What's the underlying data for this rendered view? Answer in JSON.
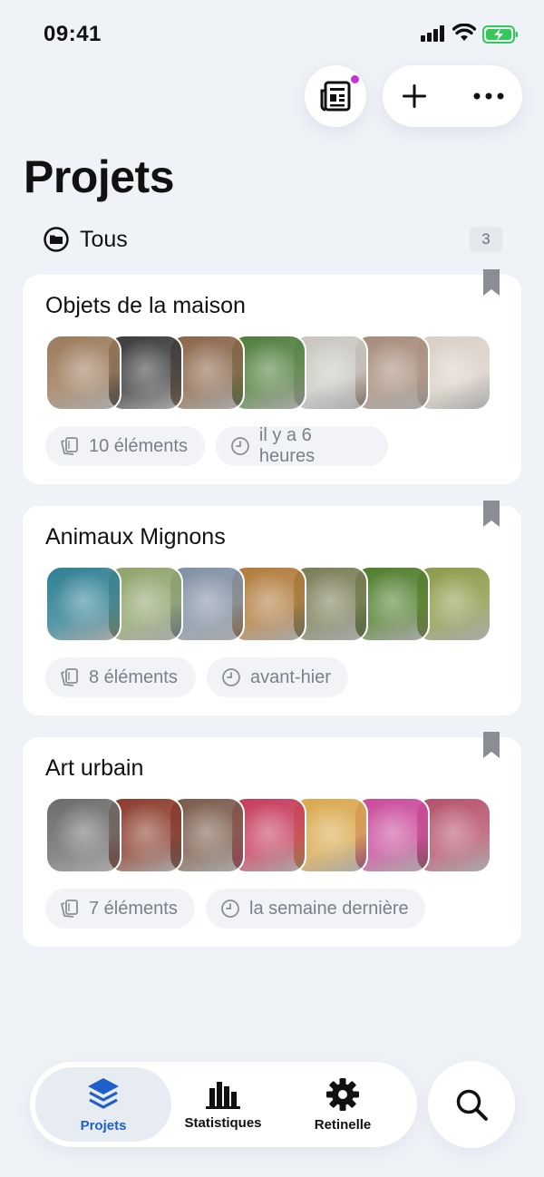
{
  "status_bar": {
    "time": "09:41"
  },
  "header": {
    "title": "Projets"
  },
  "filter": {
    "label": "Tous",
    "count": "3"
  },
  "projects": [
    {
      "title": "Objets de la maison",
      "items_label": "10 éléments",
      "updated_label": "il y a 6 heures",
      "thumbnails": [
        "dining-room",
        "living-room-sofa",
        "kitchen-sink",
        "door-in-forest",
        "bookshelf",
        "table-lamp",
        "coat-rack"
      ],
      "thumbnail_colors": [
        "#9c7a5a",
        "#3a3a3a",
        "#8a6448",
        "#4e7d3a",
        "#c9c6c2",
        "#a68a78",
        "#d9cfc4"
      ]
    },
    {
      "title": "Animaux Mignons",
      "items_label": "8 éléments",
      "updated_label": "avant-hier",
      "thumbnails": [
        "sea-turtle",
        "sheep",
        "penguins",
        "lion",
        "koala",
        "frog",
        "golden-retriever"
      ],
      "thumbnail_colors": [
        "#2f7f93",
        "#8ea36a",
        "#7f8fa3",
        "#b07a3a",
        "#7a7c56",
        "#4f7d2c",
        "#8a9a48"
      ]
    },
    {
      "title": "Art urbain",
      "items_label": "7 éléments",
      "updated_label": "la semaine dernière",
      "thumbnails": [
        "graffiti-face",
        "graffiti-portrait",
        "poster-wall",
        "colorful-door",
        "graffiti-eye",
        "rabbit-mural",
        "graffiti-woman"
      ],
      "thumbnail_colors": [
        "#6b6b6b",
        "#8a3a2a",
        "#7a5a4a",
        "#c53a5a",
        "#d9a84a",
        "#c94a9a",
        "#b5506a"
      ]
    }
  ],
  "nav": {
    "items": [
      {
        "label": "Projets",
        "icon": "layers-icon",
        "active": true
      },
      {
        "label": "Statistiques",
        "icon": "bar-chart-icon",
        "active": false
      },
      {
        "label": "Retinelle",
        "icon": "gear-icon",
        "active": false
      }
    ]
  },
  "colors": {
    "accent": "#1f5fc9",
    "notification_dot": "#c832d9",
    "background": "#eff2f7"
  }
}
